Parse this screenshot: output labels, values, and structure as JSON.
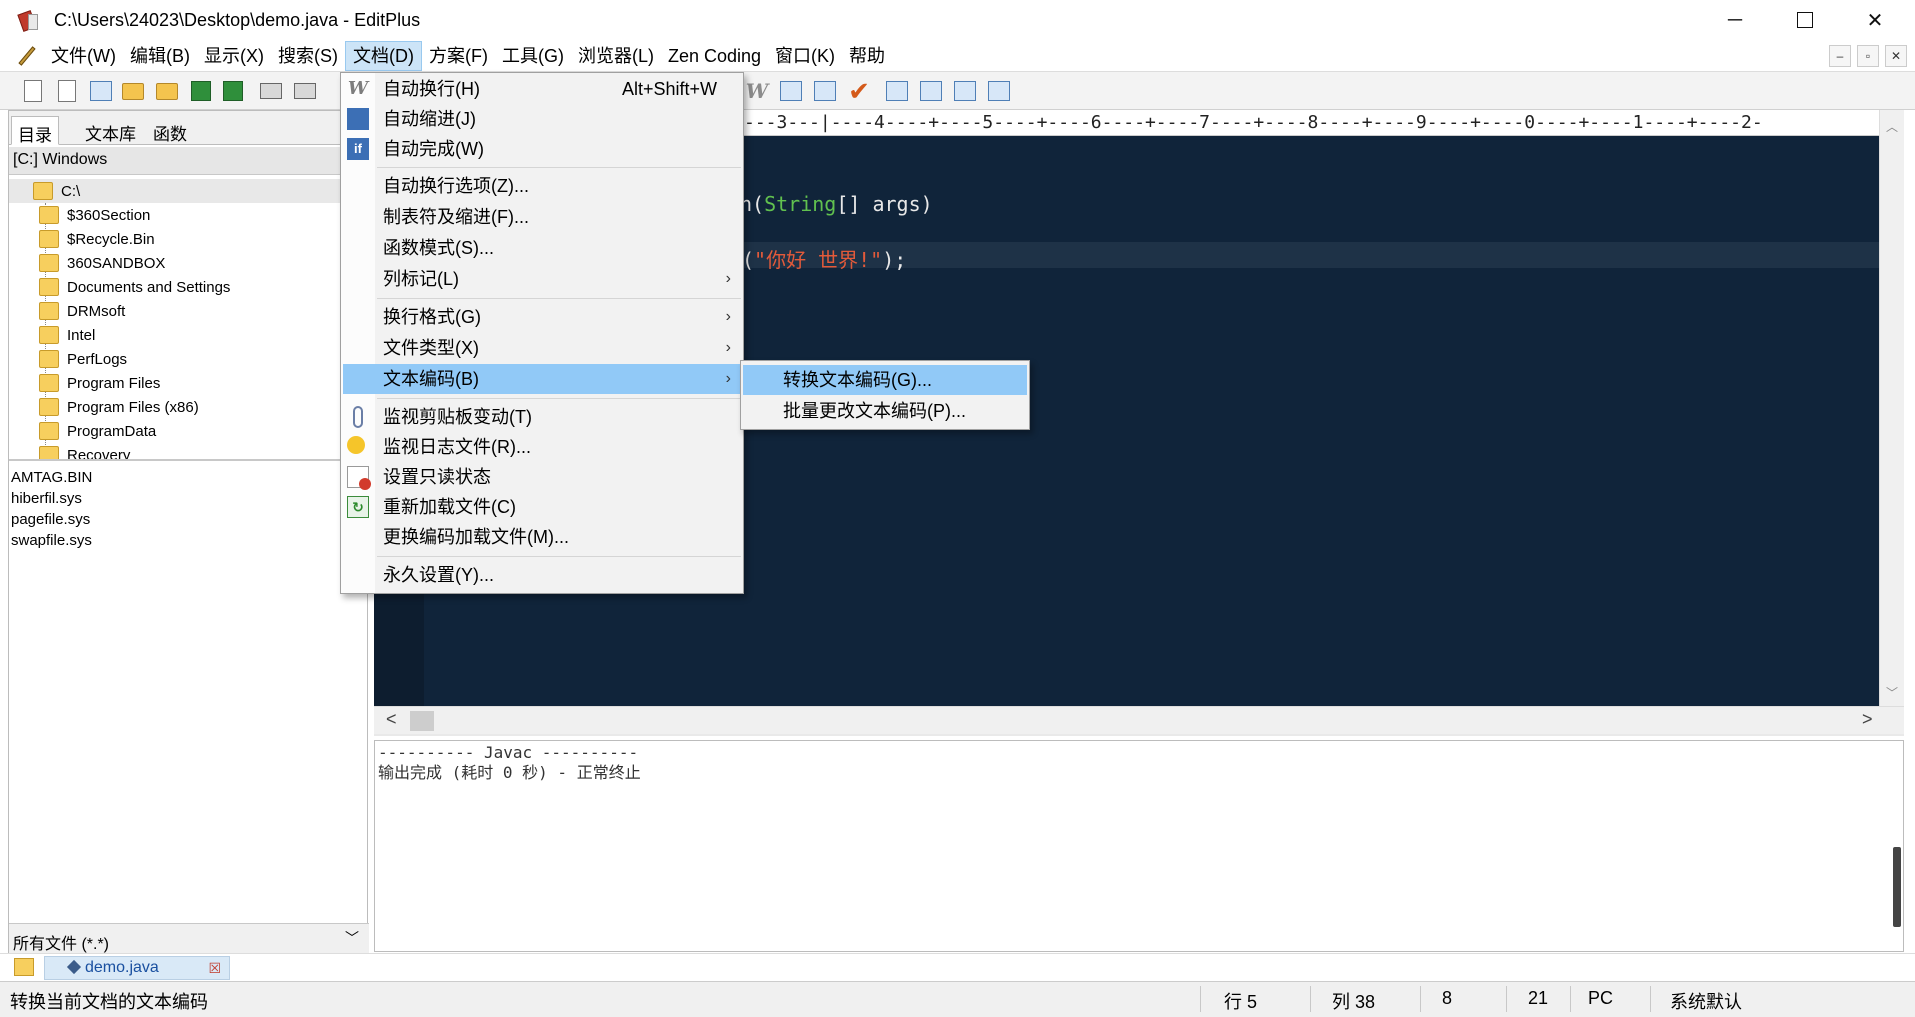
{
  "window": {
    "title": "C:\\Users\\24023\\Desktop\\demo.java - EditPlus",
    "minimize_glyph": "─",
    "close_glyph": "✕"
  },
  "menubar": {
    "items": [
      "文件(W)",
      "编辑(B)",
      "显示(X)",
      "搜索(S)",
      "文档(D)",
      "方案(F)",
      "工具(G)",
      "浏览器(L)",
      "Zen Coding",
      "窗口(K)",
      "帮助"
    ],
    "active_index": 4,
    "mdi_controls": [
      "–",
      "▫",
      "✕"
    ]
  },
  "left_panel": {
    "tabs": [
      "目录",
      "文本库",
      "函数"
    ],
    "drive": "[C:] Windows",
    "root": "C:\\",
    "folders": [
      "$360Section",
      "$Recycle.Bin",
      "360SANDBOX",
      "Documents and Settings",
      "DRMsoft",
      "Intel",
      "PerfLogs",
      "Program Files",
      "Program Files (x86)",
      "ProgramData",
      "Recovery"
    ],
    "files": [
      "AMTAG.BIN",
      "hiberfil.sys",
      "pagefile.sys",
      "swapfile.sys"
    ],
    "filter": "所有文件 (*.*)",
    "filter_chevron": "﹀"
  },
  "editor": {
    "ruler": "---3---|----4----+----5----+----6----+----7----+----8----+----9----+----0----+----1----+----2-",
    "code_line1_pre": "n(",
    "code_line1_type": "String",
    "code_line1_post": "[] args)",
    "code_line2_pre": "(",
    "code_line2_str": "\"你好 世界!\"",
    "code_line2_post": ");",
    "hscroll_left": "<",
    "hscroll_right": ">",
    "vscroll_up": "︿",
    "vscroll_down": "﹀"
  },
  "output": {
    "line1": "---------- Javac ----------",
    "line2": "输出完成 (耗时 0 秒) - 正常终止"
  },
  "document_tab": {
    "label": "demo.java",
    "close": "☒"
  },
  "statusbar": {
    "message": "转换当前文档的文本编码",
    "line": "行 5",
    "col": "列 38",
    "lines_total": "8",
    "chars": "21",
    "format": "PC",
    "encoding": "系统默认"
  },
  "doc_menu": {
    "items": [
      {
        "label": "自动换行(H)",
        "shortcut": "Alt+Shift+W",
        "icon": "word-wrap-icon"
      },
      {
        "label": "自动缩进(J)",
        "icon": "auto-indent-icon"
      },
      {
        "label": "自动完成(W)",
        "icon": "auto-complete-icon"
      },
      {
        "label": "自动换行选项(Z)..."
      },
      {
        "label": "制表符及缩进(F)..."
      },
      {
        "label": "函数模式(S)..."
      },
      {
        "label": "列标记(L)",
        "submenu": "›"
      },
      {
        "label": "换行格式(G)",
        "submenu": "›"
      },
      {
        "label": "文件类型(X)",
        "submenu": "›"
      },
      {
        "label": "文本编码(B)",
        "submenu": "›"
      },
      {
        "label": "监视剪贴板变动(T)",
        "icon": "clipboard-clip-icon"
      },
      {
        "label": "监视日志文件(R)...",
        "icon": "lightbulb-icon"
      },
      {
        "label": "设置只读状态",
        "icon": "readonly-icon"
      },
      {
        "label": "重新加载文件(C)",
        "icon": "reload-icon"
      },
      {
        "label": "更换编码加载文件(M)..."
      },
      {
        "label": "永久设置(Y)..."
      }
    ],
    "highlighted_index": 9
  },
  "encoding_submenu": {
    "items": [
      "转换文本编码(G)...",
      "批量更改文本编码(P)..."
    ],
    "highlighted_index": 0
  },
  "colors": {
    "editor_bg": "#10243a",
    "menu_highlight": "#91c9f7",
    "keyword_type": "#61c14f",
    "string": "#e35a3a"
  }
}
